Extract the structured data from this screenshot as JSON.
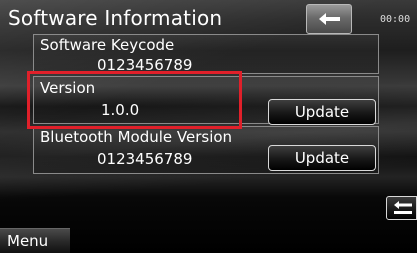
{
  "header": {
    "title": "Software Information",
    "clock": "00:00",
    "back_icon": "back-arrow-icon"
  },
  "software_keycode": {
    "label": "Software Keycode",
    "value": "0123456789"
  },
  "version": {
    "label": "Version",
    "value": "1.0.0",
    "update_label": "Update"
  },
  "bluetooth": {
    "label": "Bluetooth Module Version",
    "value": "0123456789",
    "update_label": "Update"
  },
  "side_button": {
    "icon": "return-icon"
  },
  "footer": {
    "menu_label": "Menu"
  },
  "colors": {
    "highlight": "#e0202a"
  }
}
